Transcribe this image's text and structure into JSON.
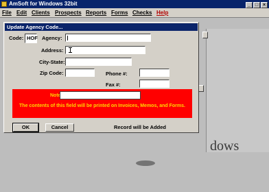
{
  "app": {
    "title": "AmSoft for Windows 32bit",
    "minimize": "_",
    "maximize": "□",
    "close": "×"
  },
  "menu": {
    "items": [
      "File",
      "Edit",
      "Clients",
      "Prospects",
      "Reports",
      "Forms",
      "Checks",
      "Help"
    ]
  },
  "dialog": {
    "title": "Update Agency Code...",
    "code_label": "Code:",
    "code_value": "HOF",
    "agency_label": "Agency:",
    "agency_value": "",
    "address_label": "Address:",
    "address_value": "",
    "city_state_label": "City-State:",
    "city_state_value": "",
    "zip_label": "Zip Code:",
    "zip_value": "",
    "phone_label": "Phone #:",
    "phone_value": "",
    "fax_label": "Fax #:",
    "fax_value": "",
    "note_label": "Note:",
    "note_value": "",
    "note_message": "The contents of this field will be printed on Invoices, Memos, and Forms.",
    "ok_label": "OK",
    "cancel_label": "Cancel",
    "status": "Record will be Added"
  },
  "background": {
    "watermark": "dows"
  }
}
